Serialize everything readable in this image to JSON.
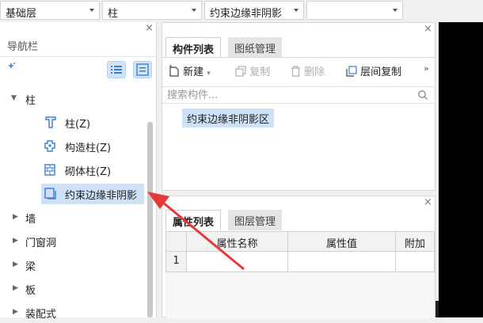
{
  "toolbar": {
    "floor_select": "基础层",
    "category_select": "柱",
    "component_select": "约束边缘非阴影",
    "extra_select": ""
  },
  "nav": {
    "title": "导航栏",
    "close": "×",
    "add_icon": "+",
    "tree": [
      {
        "label": "柱",
        "expanded": true,
        "icon": "caret-down"
      },
      {
        "label": "柱(Z)",
        "icon": "column-icon"
      },
      {
        "label": "构造柱(Z)",
        "icon": "construct-column-icon"
      },
      {
        "label": "砌体柱(Z)",
        "icon": "masonry-column-icon"
      },
      {
        "label": "约束边缘非阴影",
        "icon": "constraint-edge-icon",
        "selected": true
      },
      {
        "label": "墙",
        "icon": "caret-right"
      },
      {
        "label": "门窗洞",
        "icon": "caret-right"
      },
      {
        "label": "梁",
        "icon": "caret-right"
      },
      {
        "label": "板",
        "icon": "caret-right"
      },
      {
        "label": "装配式",
        "icon": "caret-right"
      }
    ]
  },
  "component_panel": {
    "close": "×",
    "tabs": [
      "构件列表",
      "图纸管理"
    ],
    "actions": {
      "new": "新建",
      "copy": "复制",
      "delete": "删除",
      "floor_copy": "层间复制",
      "more": "»"
    },
    "search_placeholder": "搜索构件...",
    "items": [
      "约束边缘非阴影区"
    ]
  },
  "attribute_panel": {
    "close": "×",
    "tabs": [
      "属性列表",
      "图层管理"
    ],
    "columns": [
      "属性名称",
      "属性值",
      "附加"
    ],
    "rows": [
      {
        "index": "1",
        "name": "",
        "value": "",
        "extra": ""
      }
    ]
  },
  "colors": {
    "selection": "#cfe1f7",
    "accent": "#3a7fd5",
    "arrow": "#e53935"
  }
}
